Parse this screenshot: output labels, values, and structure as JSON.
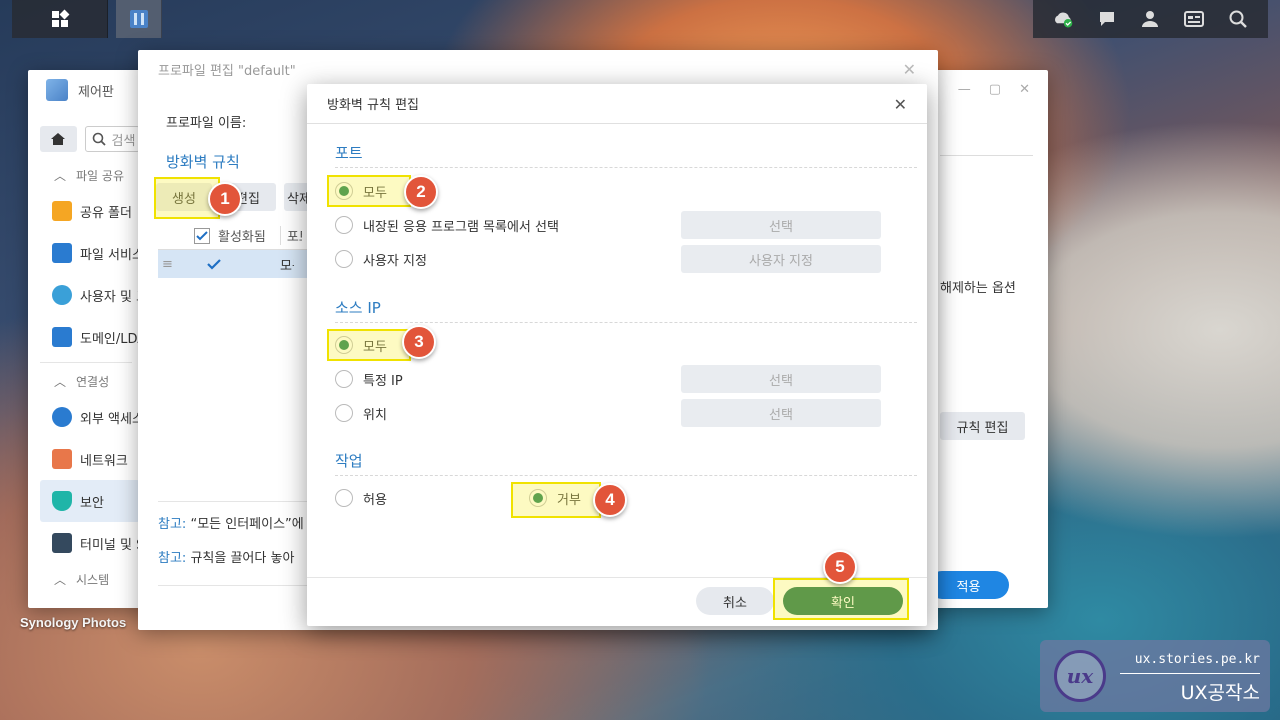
{
  "desktop": {
    "app_label": "Synology Photos"
  },
  "control_panel": {
    "title": "제어판",
    "search_placeholder": "검색",
    "sections": [
      {
        "label": "파일 공유",
        "items": [
          "공유 폴더",
          "파일 서비스",
          "사용자 및 그룹",
          "도메인/LDAP"
        ]
      },
      {
        "label": "연결성",
        "items": [
          "외부 액세스",
          "네트워크",
          "보안",
          "터미널 및 SNMP"
        ]
      },
      {
        "label": "시스템"
      }
    ],
    "selected_item": "보안",
    "right_text": "해제하는 옵션",
    "rule_edit_button": "규칙 편집",
    "apply_button": "적용"
  },
  "profile_window": {
    "title": "프로파일 편집 \"default\"",
    "name_label": "프로파일 이름:",
    "heading": "방화벽 규칙",
    "buttons": {
      "create": "생성",
      "edit": "편집",
      "delete": "삭제"
    },
    "table": {
      "col_enabled": "활성화됨",
      "col_port": "포트",
      "row_port": "모든"
    },
    "notes": [
      {
        "key": "참고:",
        "text": "“모든 인터페이스”에"
      },
      {
        "key": "참고:",
        "text": "규칙을 끌어다 놓아"
      }
    ]
  },
  "firewall_dialog": {
    "title": "방화벽 규칙 편집",
    "port": {
      "heading": "포트",
      "options": [
        {
          "label": "모두",
          "selected": true
        },
        {
          "label": "내장된 응용 프로그램 목록에서 선택",
          "selected": false,
          "button": "선택"
        },
        {
          "label": "사용자 지정",
          "selected": false,
          "button": "사용자 지정"
        }
      ]
    },
    "source_ip": {
      "heading": "소스 IP",
      "options": [
        {
          "label": "모두",
          "selected": true
        },
        {
          "label": "특정 IP",
          "selected": false,
          "button": "선택"
        },
        {
          "label": "위치",
          "selected": false,
          "button": "선택"
        }
      ]
    },
    "action": {
      "heading": "작업",
      "options": [
        {
          "label": "허용",
          "selected": false
        },
        {
          "label": "거부",
          "selected": true
        }
      ]
    },
    "cancel_button": "취소",
    "ok_button": "확인"
  },
  "step_badges": [
    "1",
    "2",
    "3",
    "4",
    "5"
  ],
  "watermark": {
    "url": "ux.stories.pe.kr",
    "brand": "UX공작소",
    "logo_text": "ux"
  },
  "colors": {
    "accent_blue": "#2d7cc1",
    "radio_green": "#0f7a4c",
    "ok_green": "#0f6b45",
    "apply_blue": "#1f86e3",
    "badge_red": "#e2553a",
    "highlight_yellow": "#f0e200"
  }
}
